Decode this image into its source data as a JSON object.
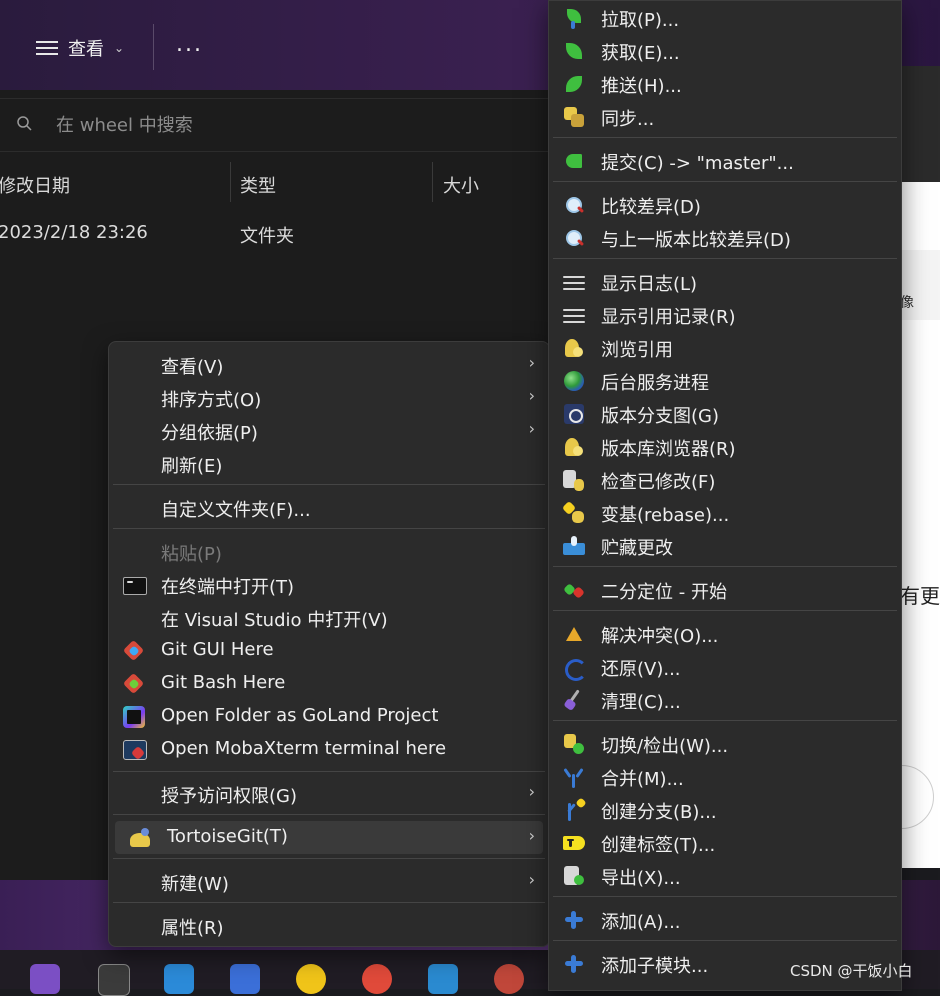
{
  "toolbar": {
    "view_label": "查看",
    "more_label": "..."
  },
  "search": {
    "placeholder": "在 wheel 中搜索"
  },
  "columns": {
    "date": "修改日期",
    "type": "类型",
    "size": "大小"
  },
  "row": {
    "date": "2023/2/18 23:26",
    "type": "文件夹"
  },
  "right_window": {
    "text1": "像",
    "text2": "有更"
  },
  "context_menu": {
    "items": [
      {
        "label": "查看(V)"
      },
      {
        "label": "排序方式(O)"
      },
      {
        "label": "分组依据(P)"
      },
      {
        "label": "刷新(E)"
      },
      {
        "label": "自定义文件夹(F)..."
      },
      {
        "label": "粘贴(P)"
      },
      {
        "label": "在终端中打开(T)"
      },
      {
        "label": "在 Visual Studio 中打开(V)"
      },
      {
        "label": "Git GUI Here"
      },
      {
        "label": "Git Bash Here"
      },
      {
        "label": "Open Folder as GoLand Project"
      },
      {
        "label": "Open MobaXterm terminal here"
      },
      {
        "label": "授予访问权限(G)"
      },
      {
        "label": "TortoiseGit(T)"
      },
      {
        "label": "新建(W)"
      },
      {
        "label": "属性(R)"
      }
    ],
    "submenu_arrow": "›"
  },
  "tortoise_menu": {
    "items": [
      {
        "label": "拉取(P)..."
      },
      {
        "label": "获取(E)..."
      },
      {
        "label": "推送(H)..."
      },
      {
        "label": "同步..."
      },
      {
        "label": "提交(C) -> \"master\"..."
      },
      {
        "label": "比较差异(D)"
      },
      {
        "label": "与上一版本比较差异(D)"
      },
      {
        "label": "显示日志(L)"
      },
      {
        "label": "显示引用记录(R)"
      },
      {
        "label": "浏览引用"
      },
      {
        "label": "后台服务进程"
      },
      {
        "label": "版本分支图(G)"
      },
      {
        "label": "版本库浏览器(R)"
      },
      {
        "label": "检查已修改(F)"
      },
      {
        "label": "变基(rebase)..."
      },
      {
        "label": "贮藏更改"
      },
      {
        "label": "二分定位 - 开始"
      },
      {
        "label": "解决冲突(O)..."
      },
      {
        "label": "还原(V)..."
      },
      {
        "label": "清理(C)..."
      },
      {
        "label": "切换/检出(W)..."
      },
      {
        "label": "合并(M)..."
      },
      {
        "label": "创建分支(B)..."
      },
      {
        "label": "创建标签(T)..."
      },
      {
        "label": "导出(X)..."
      },
      {
        "label": "添加(A)..."
      },
      {
        "label": "添加子模块..."
      }
    ]
  },
  "watermark": "CSDN @干饭小白",
  "colors": {
    "menu_bg": "#2b2b2b",
    "highlight": "#3a3a3a",
    "accent_green": "#3fbf3f",
    "accent_blue": "#3a7bd5"
  }
}
